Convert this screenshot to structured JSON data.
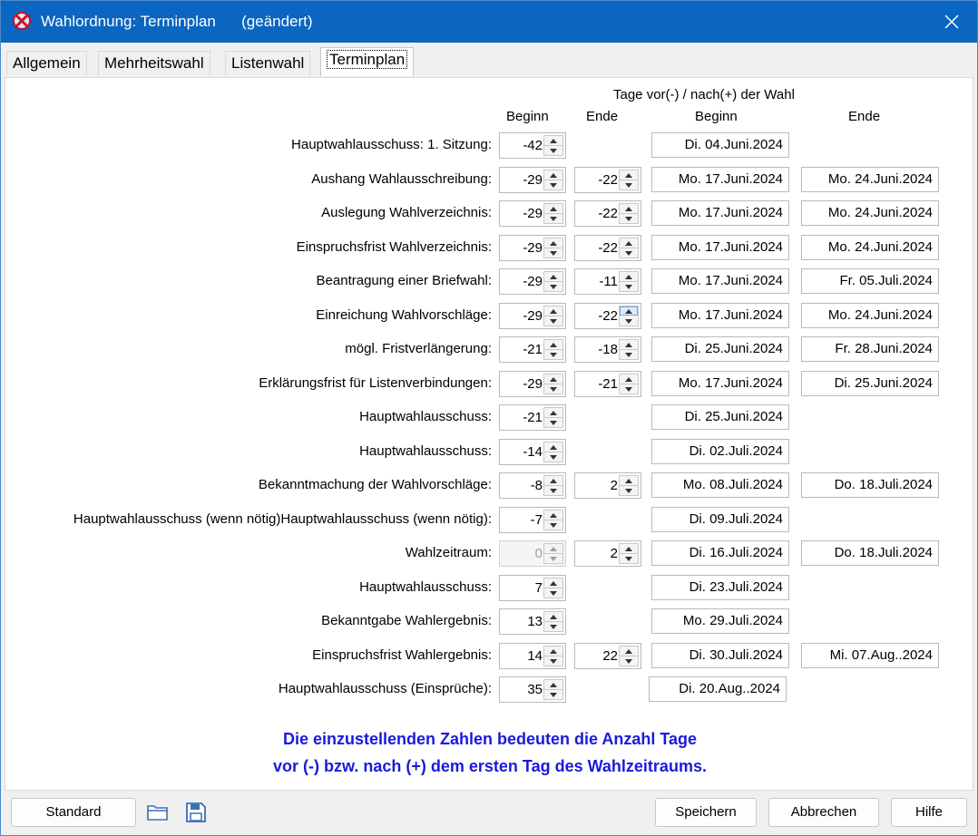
{
  "window": {
    "title": "Wahlordnung: Terminplan",
    "title_suffix": "(geändert)",
    "close_icon": "close-icon",
    "app_icon": "app-logo-icon"
  },
  "tabs": [
    {
      "label": "Allgemein",
      "active": false
    },
    {
      "label": "Mehrheitswahl",
      "active": false
    },
    {
      "label": "Listenwahl",
      "active": false
    },
    {
      "label": "Terminplan",
      "active": true
    }
  ],
  "headers": {
    "days_caption": "Tage vor(-) / nach(+) der Wahl",
    "col_begin_days": "Beginn",
    "col_end_days": "Ende",
    "col_begin_date": "Beginn",
    "col_end_date": "Ende"
  },
  "rows": [
    {
      "label": "Hauptwahlausschuss: 1. Sitzung:",
      "begin": "-42",
      "end": null,
      "begin_date": "Di. 04.Juni.2024",
      "end_date": null
    },
    {
      "label": "Aushang Wahlausschreibung:",
      "begin": "-29",
      "end": "-22",
      "begin_date": "Mo. 17.Juni.2024",
      "end_date": "Mo. 24.Juni.2024"
    },
    {
      "label": "Auslegung Wahlverzeichnis:",
      "begin": "-29",
      "end": "-22",
      "begin_date": "Mo. 17.Juni.2024",
      "end_date": "Mo. 24.Juni.2024"
    },
    {
      "label": "Einspruchsfrist Wahlverzeichnis:",
      "begin": "-29",
      "end": "-22",
      "begin_date": "Mo. 17.Juni.2024",
      "end_date": "Mo. 24.Juni.2024"
    },
    {
      "label": "Beantragung einer Briefwahl:",
      "begin": "-29",
      "end": "-11",
      "begin_date": "Mo. 17.Juni.2024",
      "end_date": "Fr. 05.Juli.2024"
    },
    {
      "label": "Einreichung Wahlvorschläge:",
      "begin": "-29",
      "end": "-22",
      "begin_date": "Mo. 17.Juni.2024",
      "end_date": "Mo. 24.Juni.2024"
    },
    {
      "label": "mögl. Fristverlängerung:",
      "begin": "-21",
      "end": "-18",
      "begin_date": "Di. 25.Juni.2024",
      "end_date": "Fr. 28.Juni.2024"
    },
    {
      "label": "Erklärungsfrist für Listenverbindungen:",
      "begin": "-29",
      "end": "-21",
      "begin_date": "Mo. 17.Juni.2024",
      "end_date": "Di. 25.Juni.2024"
    },
    {
      "label": "Hauptwahlausschuss:",
      "begin": "-21",
      "end": null,
      "begin_date": "Di. 25.Juni.2024",
      "end_date": null
    },
    {
      "label": "Hauptwahlausschuss:",
      "begin": "-14",
      "end": null,
      "begin_date": "Di. 02.Juli.2024",
      "end_date": null
    },
    {
      "label": "Bekanntmachung der  Wahlvorschläge:",
      "begin": "-8",
      "end": "2",
      "begin_date": "Mo. 08.Juli.2024",
      "end_date": "Do. 18.Juli.2024"
    },
    {
      "label": "Hauptwahlausschuss (wenn nötig)Hauptwahlausschuss (wenn nötig):",
      "begin": "-7",
      "end": null,
      "begin_date": "Di. 09.Juli.2024",
      "end_date": null
    },
    {
      "label": "Wahlzeitraum:",
      "begin": "0",
      "end": "2",
      "begin_date": "Di. 16.Juli.2024",
      "end_date": "Do. 18.Juli.2024",
      "begin_disabled": true
    },
    {
      "label": "Hauptwahlausschuss:",
      "begin": "7",
      "end": null,
      "begin_date": "Di. 23.Juli.2024",
      "end_date": null
    },
    {
      "label": "Bekanntgabe Wahlergebnis:",
      "begin": "13",
      "end": null,
      "begin_date": "Mo. 29.Juli.2024",
      "end_date": null
    },
    {
      "label": "Einspruchsfrist Wahlergebnis:",
      "begin": "14",
      "end": "22",
      "begin_date": "Di. 30.Juli.2024",
      "end_date": "Mi. 07.Aug..2024"
    },
    {
      "label": "Hauptwahlausschuss (Einsprüche):",
      "begin": "35",
      "end": null,
      "begin_date": "Di. 20.Aug..2024",
      "end_date": null
    }
  ],
  "info": {
    "line1": "Die einzustellenden Zahlen bedeuten die Anzahl Tage",
    "line2": "vor (-) bzw. nach (+) dem ersten Tag des Wahlzeitraums."
  },
  "buttons": {
    "standard": "Standard",
    "save": "Speichern",
    "cancel": "Abbrechen",
    "help": "Hilfe",
    "open_icon": "folder-open-icon",
    "save_icon": "floppy-disk-icon"
  },
  "colors": {
    "titlebar": "#0a66c0",
    "info_text": "#1a1adc",
    "icon_blue": "#3d6fb4"
  }
}
